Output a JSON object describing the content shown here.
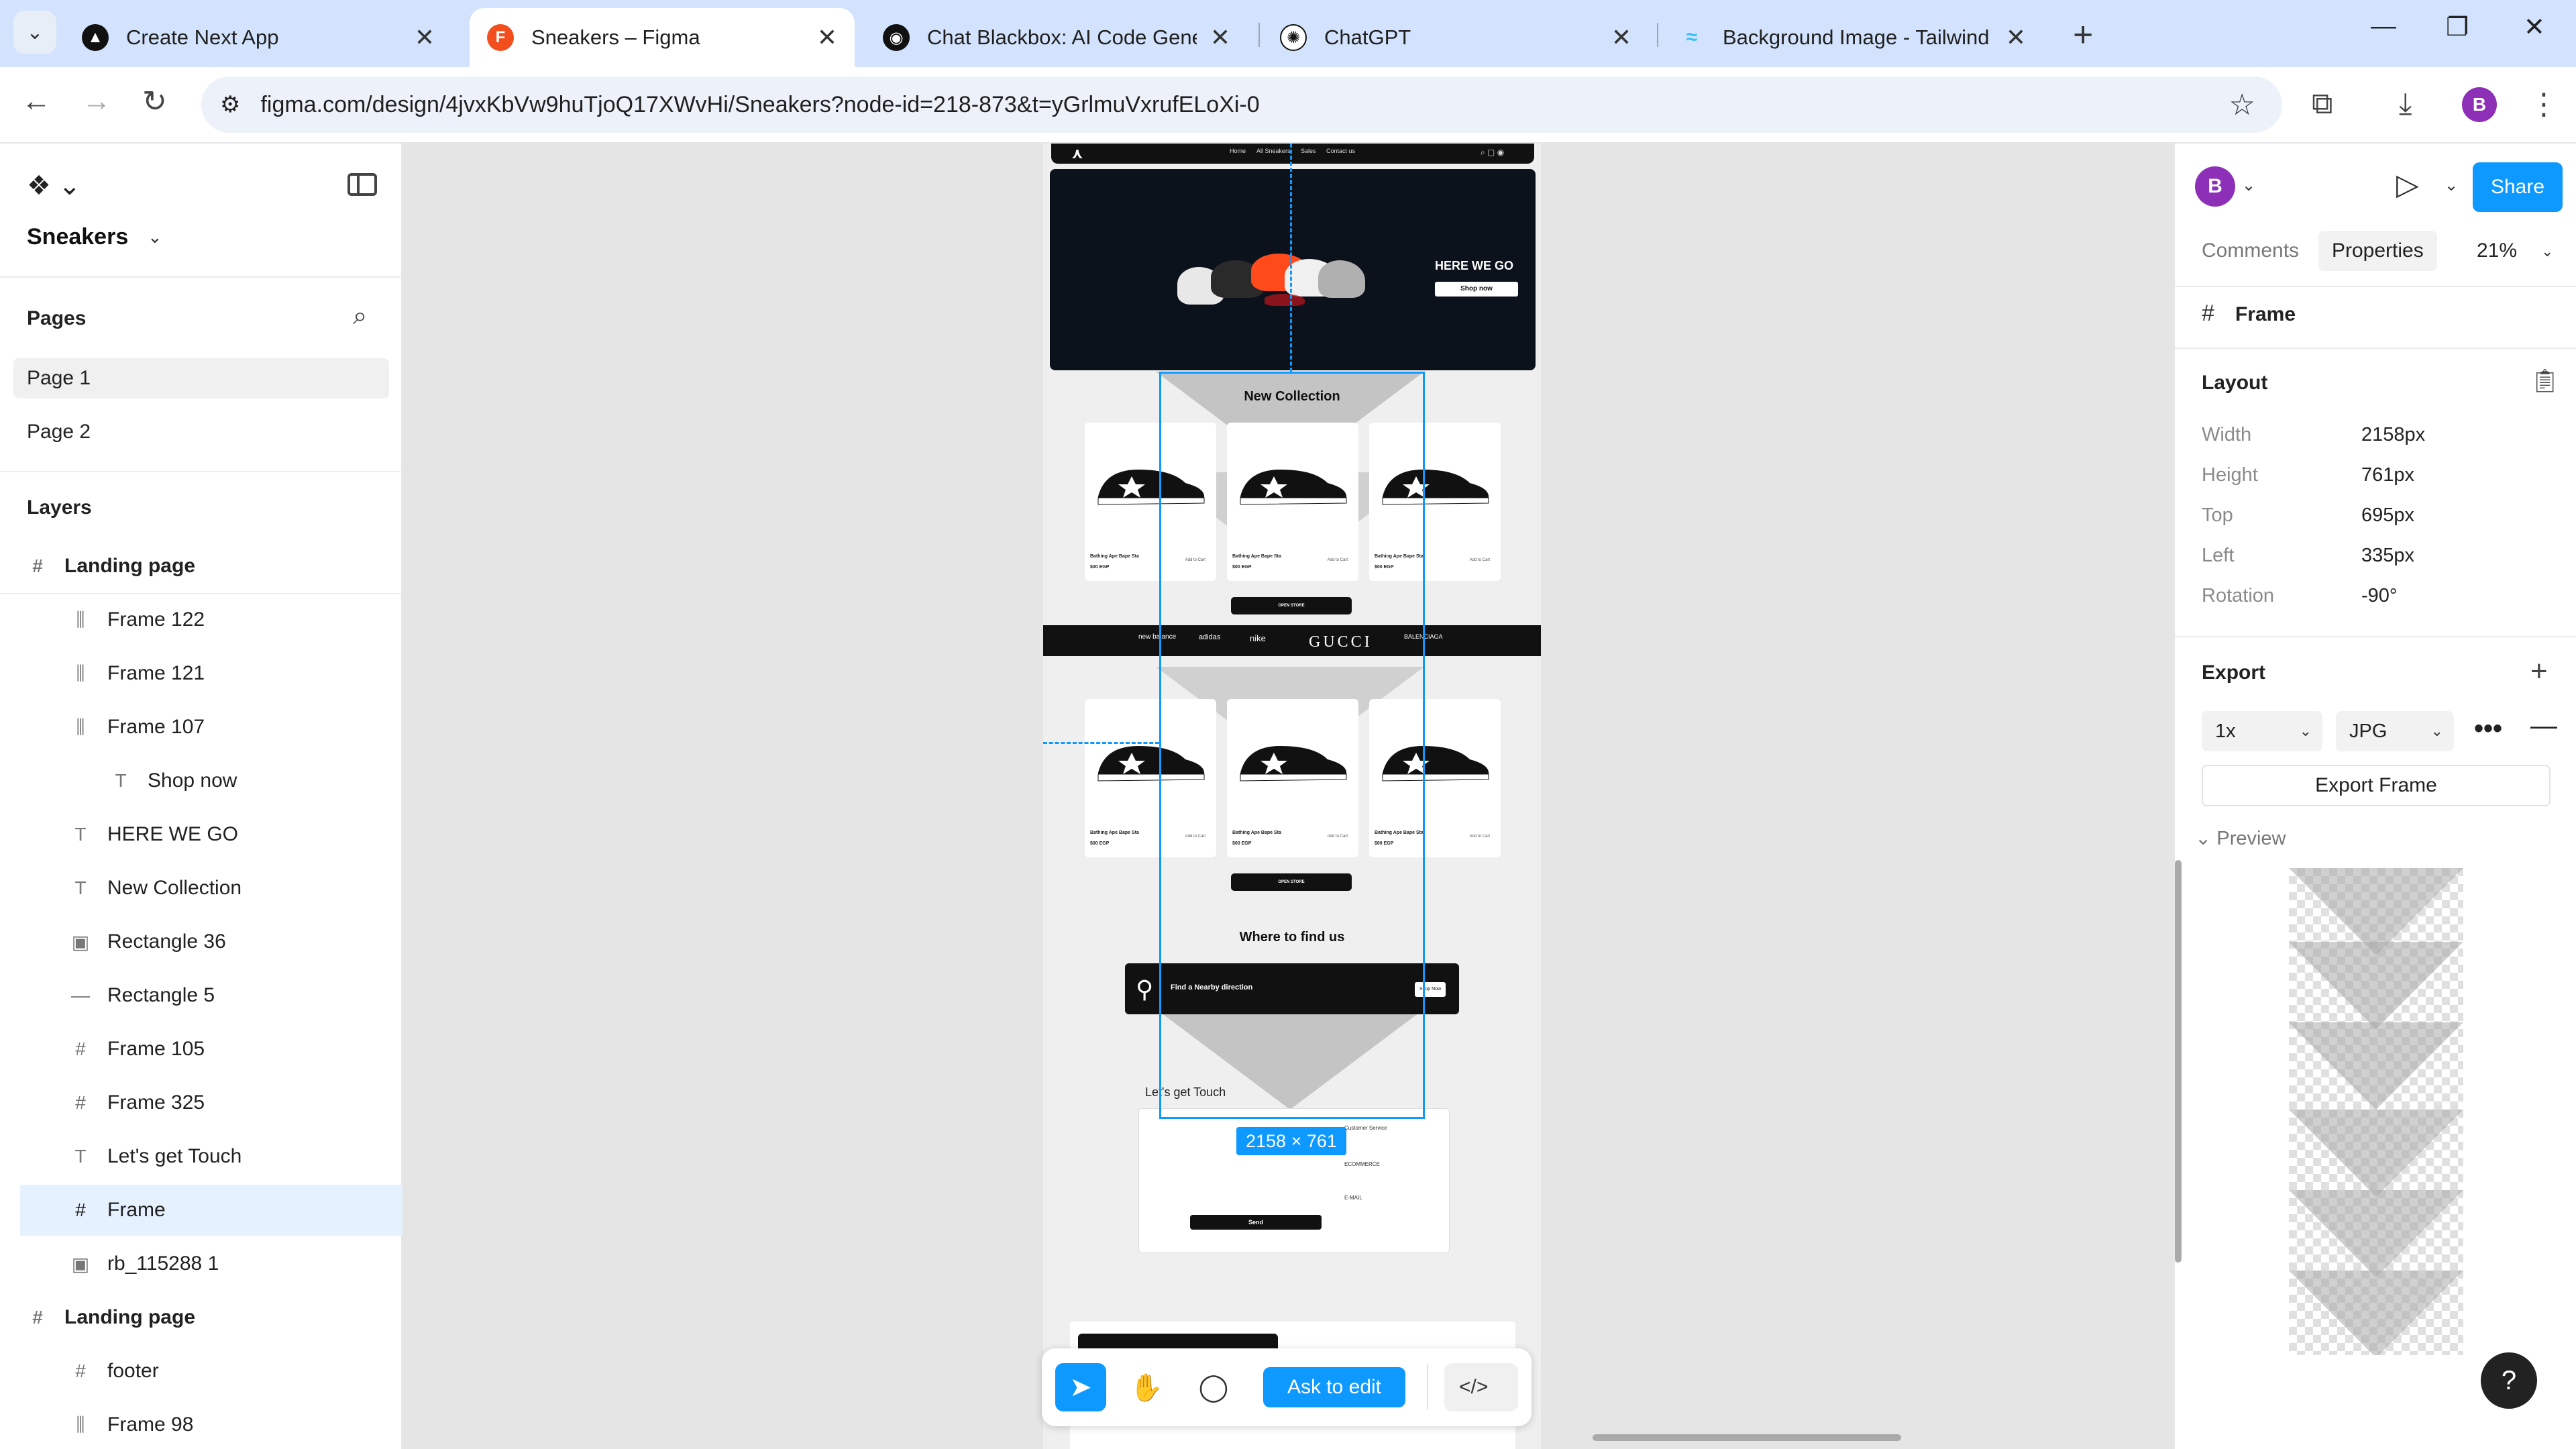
{
  "browser": {
    "tabs": [
      {
        "title": "Create Next App",
        "active": false
      },
      {
        "title": "Sneakers – Figma",
        "active": true
      },
      {
        "title": "Chat Blackbox: AI Code Generat",
        "active": false
      },
      {
        "title": "ChatGPT",
        "active": false
      },
      {
        "title": "Background Image - Tailwind C",
        "active": false
      }
    ],
    "url": "figma.com/design/4jvxKbVw9huTjoQ17XWvHi/Sneakers?node-id=218-873&t=yGrlmuVxrufELoXi-0",
    "profile_initial": "B"
  },
  "left_panel": {
    "file_name": "Sneakers",
    "pages_title": "Pages",
    "pages": [
      "Page 1",
      "Page 2"
    ],
    "layers_title": "Layers",
    "layers": [
      {
        "name": "Landing page",
        "icon": "frame-icon",
        "parent": true
      },
      {
        "name": "Frame 122",
        "icon": "auto-layout-icon"
      },
      {
        "name": "Frame 121",
        "icon": "auto-layout-icon"
      },
      {
        "name": "Frame 107",
        "icon": "auto-layout-icon"
      },
      {
        "name": "Shop now",
        "icon": "text-icon"
      },
      {
        "name": "HERE WE GO",
        "icon": "text-icon"
      },
      {
        "name": "New Collection",
        "icon": "text-icon"
      },
      {
        "name": "Rectangle 36",
        "icon": "image-icon"
      },
      {
        "name": "Rectangle 5",
        "icon": "line-icon"
      },
      {
        "name": "Frame 105",
        "icon": "frame-icon"
      },
      {
        "name": "Frame 325",
        "icon": "frame-icon"
      },
      {
        "name": "Let's get Touch",
        "icon": "text-icon"
      },
      {
        "name": "Frame",
        "icon": "frame-icon",
        "selected": true
      },
      {
        "name": "rb_115288 1",
        "icon": "image-icon"
      },
      {
        "name": "Landing page",
        "icon": "frame-icon",
        "parent": true
      },
      {
        "name": "footer",
        "icon": "frame-icon"
      },
      {
        "name": "Frame 98",
        "icon": "auto-layout-icon"
      }
    ]
  },
  "canvas": {
    "nav_links": [
      "Home",
      "All Sneakers",
      "Sales",
      "Contact us"
    ],
    "hero_title": "HERE WE GO",
    "hero_button": "Shop now",
    "new_collection": "New Collection",
    "product_name": "Bathing Ape Bape Sta",
    "product_price": "$00 EGP",
    "product_cart": "Add to Cart",
    "open_store": "OPEN STORE",
    "brands": [
      "new balance",
      "adidas",
      "nike",
      "GUCCI",
      "BALENCIAGA"
    ],
    "find_title": "Where to find us",
    "find_text": "Find a Nearby direction",
    "find_button": "Shop Now",
    "touch_title": "Let's get Touch",
    "send_label": "Send",
    "customer_service": "Customer Service",
    "ecommerce": "ECOMMERCE",
    "email_label": "E-MAIL",
    "selection_size": "2158 × 761"
  },
  "toolbar": {
    "ask_label": "Ask to edit",
    "code_label": "</>"
  },
  "right_panel": {
    "share_label": "Share",
    "tabs": [
      "Comments",
      "Properties"
    ],
    "zoom": "21%",
    "frame_label": "Frame",
    "layout_title": "Layout",
    "props": [
      {
        "label": "Width",
        "value": "2158px"
      },
      {
        "label": "Height",
        "value": "761px"
      },
      {
        "label": "Top",
        "value": "695px"
      },
      {
        "label": "Left",
        "value": "335px"
      },
      {
        "label": "Rotation",
        "value": "-90°"
      }
    ],
    "export_title": "Export",
    "export_scale": "1x",
    "export_format": "JPG",
    "export_button": "Export Frame",
    "preview_label": "Preview",
    "help_label": "?"
  },
  "colors": {
    "figma_blue": "#0d99ff",
    "avatar_purple": "#8e2fb8",
    "tab_bar": "#d3e3fd"
  }
}
